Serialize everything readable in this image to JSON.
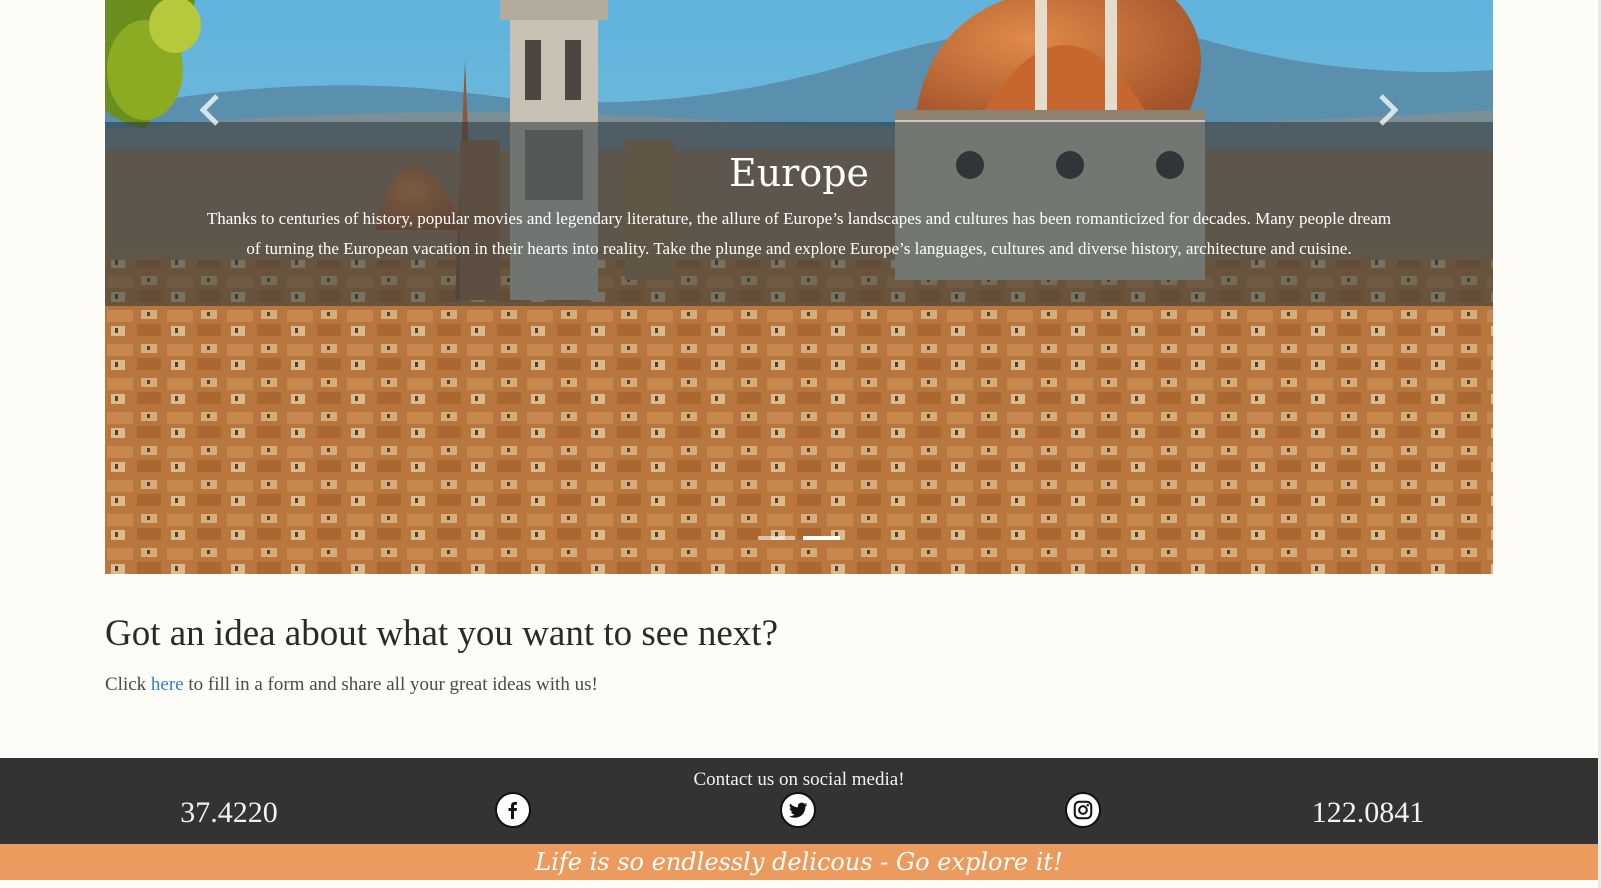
{
  "carousel": {
    "slide_title": "Europe",
    "slide_text": "Thanks to centuries of history, popular movies and legendary literature, the allure of Europe’s landscapes and cultures has been romanticized for decades. Many people dream of turning the European vacation in their hearts into reality. Take the plunge and explore Europe’s languages, cultures and diverse history, architecture and cuisine.",
    "prev_icon": "chevron-left-icon",
    "next_icon": "chevron-right-icon",
    "indicators": [
      {
        "active": false
      },
      {
        "active": true
      }
    ]
  },
  "idea": {
    "heading": "Got an idea about what you want to see next?",
    "text_before": "Click",
    "link_text": "here",
    "text_after": "to fill in a form and share all your great ideas with us!"
  },
  "footer": {
    "title": "Contact us on social media!",
    "coord_left": "37.4220",
    "coord_right": "122.0841",
    "social": [
      "facebook-icon",
      "twitter-icon",
      "instagram-icon"
    ]
  },
  "tagline": "Life is so endlessly delicous - Go explore it!",
  "colors": {
    "page_bg": "#fdfcf7",
    "footer_bg": "#333333",
    "tagline_bg": "#eb9b5e",
    "link": "#2e7fcf"
  }
}
